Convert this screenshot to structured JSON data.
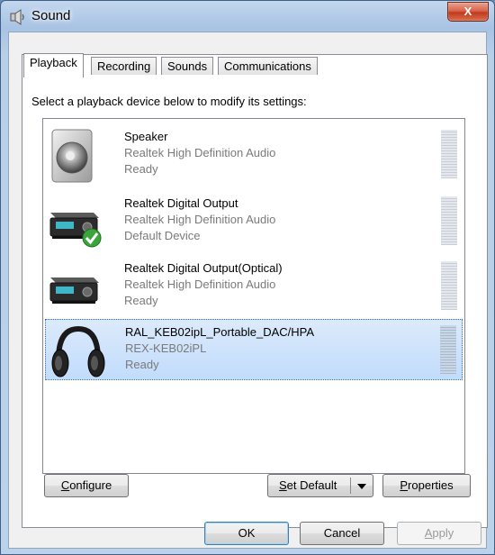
{
  "window": {
    "title": "Sound",
    "close_label": "X"
  },
  "tabs": [
    {
      "label": "Playback",
      "active": true
    },
    {
      "label": "Recording",
      "active": false
    },
    {
      "label": "Sounds",
      "active": false
    },
    {
      "label": "Communications",
      "active": false
    }
  ],
  "instruction": "Select a playback device below to modify its settings:",
  "devices": [
    {
      "name": "Speaker",
      "driver": "Realtek High Definition Audio",
      "status": "Ready",
      "icon": "speaker-icon",
      "selected": false
    },
    {
      "name": "Realtek Digital Output",
      "driver": "Realtek High Definition Audio",
      "status": "Default Device",
      "icon": "digital-output-icon",
      "selected": false,
      "default": true
    },
    {
      "name": "Realtek Digital Output(Optical)",
      "driver": "Realtek High Definition Audio",
      "status": "Ready",
      "icon": "digital-output-icon",
      "selected": false
    },
    {
      "name": "RAL_KEB02ipL_Portable_DAC/HPA",
      "driver": "REX-KEB02iPL",
      "status": "Ready",
      "icon": "headphones-icon",
      "selected": true
    }
  ],
  "buttons": {
    "configure": {
      "label": "onfigure",
      "mnemonic": "C"
    },
    "set_default": {
      "label": "et Default",
      "mnemonic": "S"
    },
    "properties": {
      "label": "roperties",
      "mnemonic": "P"
    },
    "ok": "OK",
    "cancel": "Cancel",
    "apply": {
      "label": "pply",
      "mnemonic": "A"
    }
  },
  "colors": {
    "selection": "#c1dcfc",
    "title_bar": "#a8c3e3",
    "close_button": "#c2391b"
  }
}
